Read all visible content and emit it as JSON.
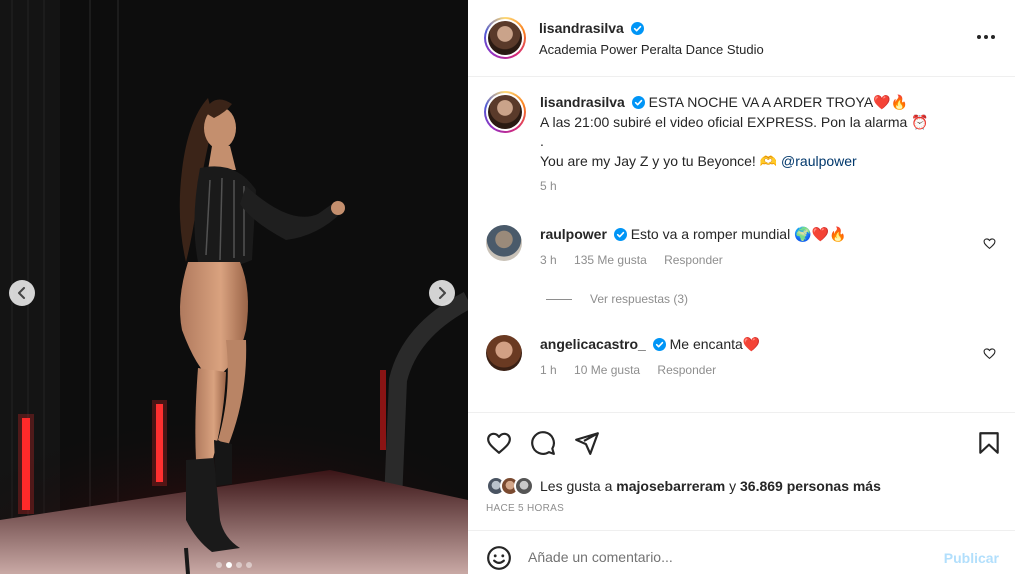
{
  "post": {
    "author": "lisandrasilva",
    "location": "Academia Power Peralta Dance Studio",
    "caption_line1": "ESTA NOCHE VA A ARDER TROYA❤️🔥",
    "caption_line2": "A las 21:00 subiré el video oficial EXPRESS. Pon la alarma ⏰",
    "caption_line3": ".",
    "caption_line4_prefix": "You are my Jay Z y yo tu Beyonce! 🫶 ",
    "caption_mention": "@raulpower",
    "caption_time": "5 h"
  },
  "comments": [
    {
      "user": "raulpower",
      "text": "Esto va a romper mundial 🌍❤️🔥",
      "time": "3 h",
      "likes": "135 Me gusta",
      "reply_label": "Responder"
    },
    {
      "user": "angelicacastro_",
      "text": "Me encanta❤️",
      "time": "1 h",
      "likes": "10 Me gusta",
      "reply_label": "Responder"
    }
  ],
  "view_replies": "Ver respuestas (3)",
  "likes": {
    "prefix": "Les gusta a ",
    "user": "majosebarreram",
    "middle": " y ",
    "count": "36.869 personas más"
  },
  "time_ago": "HACE 5 HORAS",
  "add_comment": {
    "placeholder": "Añade un comentario...",
    "publish_label": "Publicar"
  },
  "carousel": {
    "total": 4,
    "active_index": 1
  },
  "colors": {
    "verified": "#0095f6",
    "link": "#00376b",
    "publish_disabled": "#b2dffc",
    "like_red": "#ed4956"
  },
  "icons": [
    "more-options-icon",
    "heart-icon",
    "comment-icon",
    "share-icon",
    "bookmark-icon",
    "emoji-icon",
    "chevron-left-icon",
    "chevron-right-icon",
    "verified-icon"
  ]
}
